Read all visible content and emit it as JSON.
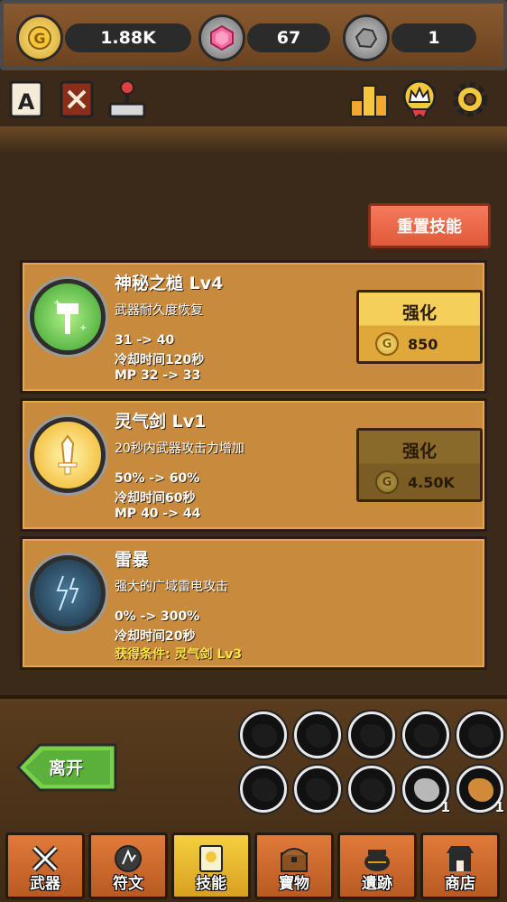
{
  "resources": {
    "gold": {
      "value": "1.88K",
      "icon": "gold-coin-icon"
    },
    "gem": {
      "value": "67",
      "icon": "pink-gem-icon"
    },
    "ore": {
      "value": "1",
      "icon": "ore-stone-icon"
    }
  },
  "top_icons": [
    {
      "name": "achievement-scroll-icon",
      "label": "A"
    },
    {
      "name": "weapon-book-icon"
    },
    {
      "name": "arcade-joystick-icon"
    },
    {
      "name": "leaderboard-podium-icon"
    },
    {
      "name": "crown-badge-icon"
    },
    {
      "name": "settings-gear-icon"
    }
  ],
  "reset_button": "重置技能",
  "skills": [
    {
      "name": "神秘之槌 Lv4",
      "desc": "武器耐久度恢复",
      "lines": [
        "31 -> 40",
        "冷却时间120秒",
        "MP 32 -> 33"
      ],
      "upgrade_label": "强化",
      "cost": "850",
      "state": "active",
      "icon_color": "#5ecf4a"
    },
    {
      "name": "灵气剑 Lv1",
      "desc": "20秒内武器攻击力增加",
      "lines": [
        "50% -> 60%",
        "冷却时间60秒",
        "MP 40 -> 44"
      ],
      "upgrade_label": "强化",
      "cost": "4.50K",
      "state": "disabled",
      "icon_color": "#f4c83a"
    },
    {
      "name": "雷暴",
      "desc": "强大的广域雷电攻击",
      "lines": [
        "0% -> 300%",
        "冷却时间20秒"
      ],
      "requirement": "获得条件: 灵气剑 Lv3",
      "icon_color": "#3a6a8a"
    }
  ],
  "leave_button": "离开",
  "inventory_counts": [
    "1",
    "1"
  ],
  "nav": [
    {
      "label": "武器",
      "icon": "crossed-swords-icon"
    },
    {
      "label": "符文",
      "icon": "rune-stone-icon"
    },
    {
      "label": "技能",
      "icon": "skill-book-icon",
      "active": true
    },
    {
      "label": "寶物",
      "icon": "treasure-chest-icon"
    },
    {
      "label": "遺跡",
      "icon": "ruins-pot-icon"
    },
    {
      "label": "商店",
      "icon": "shop-stall-icon"
    }
  ],
  "colors": {
    "accent": "#c88a3c",
    "reset": "#e86a48",
    "active_tab": "#f4d040"
  }
}
